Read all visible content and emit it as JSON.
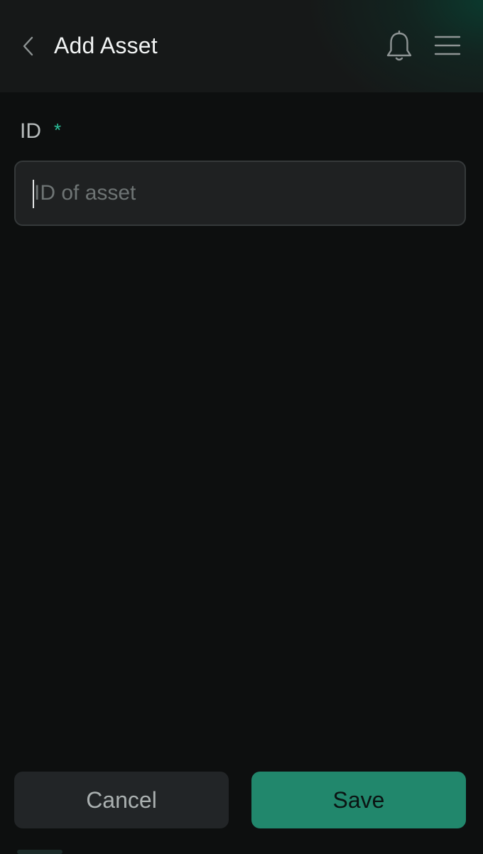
{
  "header": {
    "title": "Add Asset",
    "back_icon": "chevron-left-icon",
    "notifications_icon": "bell-icon",
    "menu_icon": "hamburger-menu-icon"
  },
  "form": {
    "id_field": {
      "label": "ID",
      "required_marker": "*",
      "value": "",
      "placeholder": "ID of asset"
    }
  },
  "actions": {
    "cancel_label": "Cancel",
    "save_label": "Save"
  },
  "colors": {
    "background": "#0d0f0f",
    "accent": "#21876c",
    "required": "#2bc09a",
    "input_background": "#1f2122"
  }
}
